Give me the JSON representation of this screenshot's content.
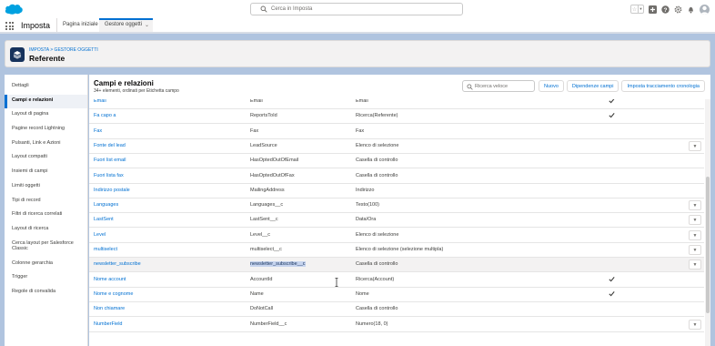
{
  "header": {
    "search_placeholder": "Cerca in Imposta",
    "icons": [
      "favorites-star-icon",
      "add-icon",
      "help-icon",
      "gear-icon",
      "bell-icon",
      "avatar-icon"
    ]
  },
  "nav": {
    "app_name": "Imposta",
    "tabs": [
      {
        "label": "Pagina iniziale"
      },
      {
        "label": "Gestore oggetti"
      }
    ]
  },
  "page": {
    "breadcrumb": "IMPOSTA > GESTORE OGGETTI",
    "title": "Referente"
  },
  "sidebar": {
    "items": [
      {
        "label": "Dettagli"
      },
      {
        "label": "Campi e relazioni"
      },
      {
        "label": "Layout di pagina"
      },
      {
        "label": "Pagine record Lightning"
      },
      {
        "label": "Pulsanti, Link e Azioni"
      },
      {
        "label": "Layout compatti"
      },
      {
        "label": "Insiemi di campi"
      },
      {
        "label": "Limiti oggetti"
      },
      {
        "label": "Tipi di record"
      },
      {
        "label": "Filtri di ricerca correlati"
      },
      {
        "label": "Layout di ricerca"
      },
      {
        "label": "Cerca layout per Salesforce Classic"
      },
      {
        "label": "Colonne gerarchia"
      },
      {
        "label": "Trigger"
      },
      {
        "label": "Regole di convalida"
      }
    ]
  },
  "main": {
    "title": "Campi e relazioni",
    "subtitle": "34+ elementi, ordinati per Etichetta campo",
    "quick_search_placeholder": "Ricerca veloce",
    "buttons": {
      "new": "Nuovo",
      "dependencies": "Dipendenze campi",
      "history": "Imposta tracciamento cronologia"
    },
    "rows": [
      {
        "label": "Email",
        "api": "Email",
        "type": "Email",
        "check": true,
        "menu": false
      },
      {
        "label": "Fa capo a",
        "api": "ReportsToId",
        "type": "Ricerca(Referente)",
        "check": true,
        "menu": false
      },
      {
        "label": "Fax",
        "api": "Fax",
        "type": "Fax",
        "check": false,
        "menu": false
      },
      {
        "label": "Fonte del lead",
        "api": "LeadSource",
        "type": "Elenco di selezione",
        "check": false,
        "menu": true
      },
      {
        "label": "Fuori list email",
        "api": "HasOptedOutOfEmail",
        "type": "Casella di controllo",
        "check": false,
        "menu": false
      },
      {
        "label": "Fuori lista fax",
        "api": "HasOptedOutOfFax",
        "type": "Casella di controllo",
        "check": false,
        "menu": false
      },
      {
        "label": "Indirizzo postale",
        "api": "MailingAddress",
        "type": "Indirizzo",
        "check": false,
        "menu": false
      },
      {
        "label": "Languages",
        "api": "Languages__c",
        "type": "Testo(100)",
        "check": false,
        "menu": true
      },
      {
        "label": "LastSent",
        "api": "LastSent__c",
        "type": "Data/Ora",
        "check": false,
        "menu": true
      },
      {
        "label": "Level",
        "api": "Level__c",
        "type": "Elenco di selezione",
        "check": false,
        "menu": true
      },
      {
        "label": "multiselect",
        "api": "multiselect__c",
        "type": "Elenco di selezione (selezione multipla)",
        "check": false,
        "menu": true
      },
      {
        "label": "newsletter_subscribe",
        "api": "newsletter_subscribe__c",
        "type": "Casella di controllo",
        "check": false,
        "menu": true
      },
      {
        "label": "Nome account",
        "api": "AccountId",
        "type": "Ricerca(Account)",
        "check": true,
        "menu": false
      },
      {
        "label": "Nome e cognome",
        "api": "Name",
        "type": "Nome",
        "check": true,
        "menu": false
      },
      {
        "label": "Non chiamare",
        "api": "DoNotCall",
        "type": "Casella di controllo",
        "check": false,
        "menu": false
      },
      {
        "label": "NumberField",
        "api": "NumberField__c",
        "type": "Numero(18, 0)",
        "check": false,
        "menu": true
      }
    ]
  },
  "colors": {
    "brand": "#0070d2",
    "page_bg": "#b0c4df",
    "header_icon": "#16325c"
  }
}
